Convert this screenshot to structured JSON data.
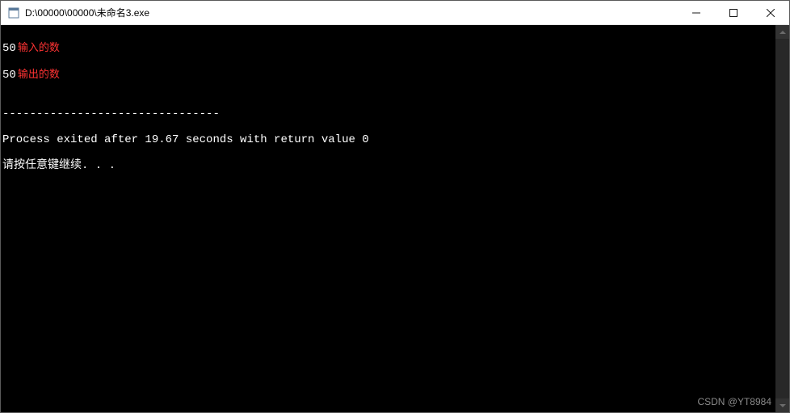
{
  "window": {
    "title": "D:\\00000\\00000\\未命名3.exe"
  },
  "console": {
    "line1_value": "50",
    "line1_annotation": "输入的数",
    "line2_value": "50",
    "line2_annotation": "输出的数",
    "blank_line": "",
    "separator": "--------------------------------",
    "process_exit": "Process exited after 19.67 seconds with return value 0",
    "continue_prompt": "请按任意键继续. . ."
  },
  "watermark": "CSDN @YT8984"
}
